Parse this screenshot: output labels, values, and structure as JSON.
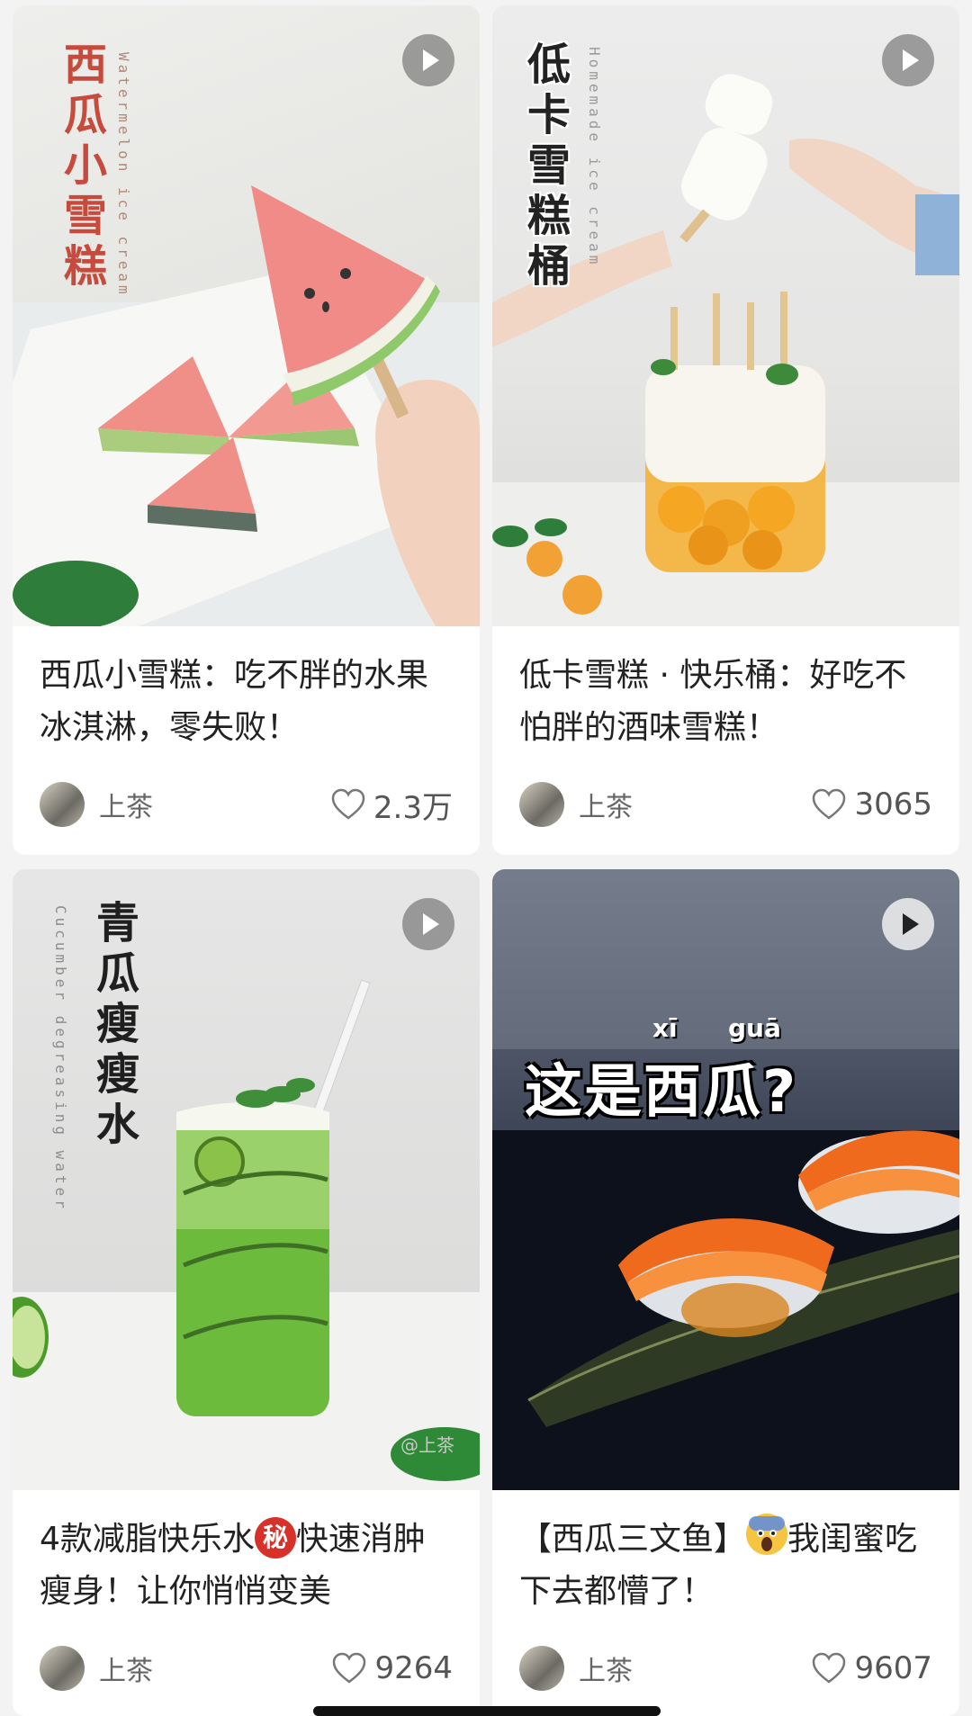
{
  "feed": {
    "cards": [
      {
        "overlay_title": "西瓜小雪糕",
        "overlay_subtitle": "Watermelon ice cream",
        "title": "西瓜小雪糕：吃不胖的水果冰淇淋，零失败！",
        "author": "上茶",
        "likes": "2.3万"
      },
      {
        "overlay_title": "低卡雪糕桶",
        "overlay_subtitle": "Homemade ice cream",
        "title": "低卡雪糕 · 快乐桶：好吃不怕胖的酒味雪糕！",
        "author": "上茶",
        "likes": "3065"
      },
      {
        "overlay_title": "青瓜瘦瘦水",
        "overlay_subtitle": "Cucumber degreasing water",
        "watermark": "@上茶",
        "title_before": "4款减脂快乐水",
        "badge": "秘",
        "title_after": "快速消肿瘦身！让你悄悄变美",
        "author": "上茶",
        "likes": "9264"
      },
      {
        "overlay_pinyin_1": "xī",
        "overlay_pinyin_2": "guā",
        "overlay_title": "这是西瓜?",
        "title_before": "【西瓜三文鱼】",
        "title_after": "我闺蜜吃下去都懵了！",
        "author": "上茶",
        "likes": "9607"
      }
    ]
  },
  "colors": {
    "background": "#f3f3f3",
    "card": "#ffffff",
    "title_text": "#222222",
    "meta_text": "#666666",
    "secret_badge": "#d8312a"
  },
  "icons": [
    "play-icon",
    "heart-icon",
    "screaming-face-emoji"
  ]
}
